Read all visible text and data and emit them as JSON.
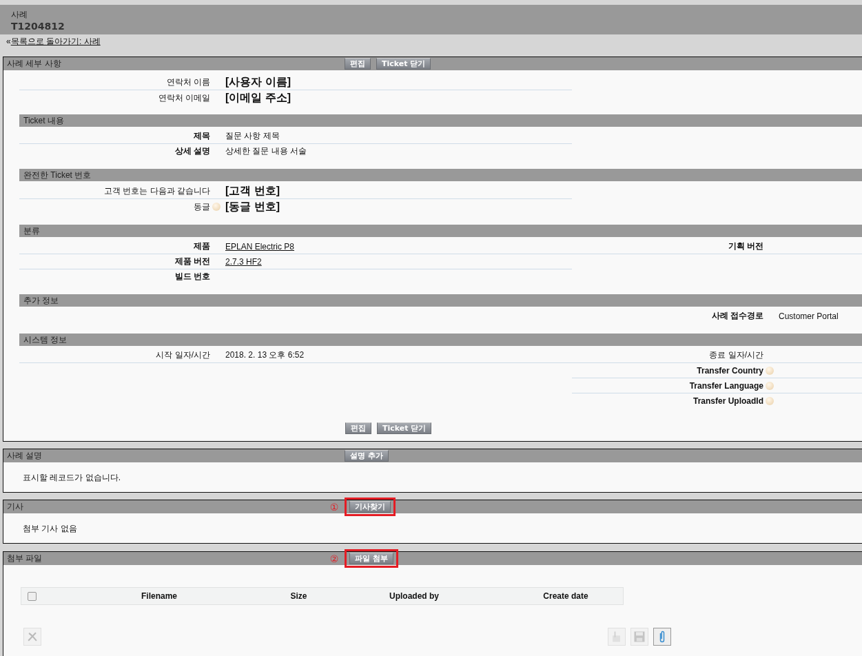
{
  "header": {
    "object_type": "사례",
    "record_number": "T1204812"
  },
  "back_link": {
    "prefix": "«",
    "label": "목록으로 돌아가기: 사례"
  },
  "detail_panel": {
    "title": "사례 세부 사항",
    "buttons": [
      "편집",
      "Ticket 닫기"
    ],
    "sections": [
      {
        "rows": [
          {
            "left": {
              "label": "연락처 이름",
              "bold": false,
              "value": "[사용자 이름]",
              "kind": "large",
              "help": false
            }
          },
          {
            "left": {
              "label": "연락처 이메일",
              "bold": false,
              "value": "[이메일 주소]",
              "kind": "large",
              "help": false
            }
          }
        ]
      },
      {
        "title": "Ticket 내용",
        "rows": [
          {
            "left": {
              "label": "제목",
              "bold": true,
              "value": "질문 사항 제목",
              "kind": "text",
              "help": false
            }
          },
          {
            "left": {
              "label": "상세 설명",
              "bold": true,
              "value": "상세한 질문 내용 서술",
              "kind": "text",
              "help": false
            }
          }
        ]
      },
      {
        "title": "완전한 Ticket 번호",
        "rows": [
          {
            "left": {
              "label": "고객 번호는 다음과 같습니다",
              "bold": false,
              "value": "[고객 번호]",
              "kind": "large",
              "help": false
            }
          },
          {
            "left": {
              "label": "동글",
              "bold": false,
              "value": "[동글 번호]",
              "kind": "large",
              "help": true
            }
          }
        ]
      },
      {
        "title": "분류",
        "rows": [
          {
            "left": {
              "label": "제품",
              "bold": true,
              "value": "EPLAN Electric P8",
              "kind": "link",
              "help": false
            },
            "right": {
              "label": "기획 버전",
              "bold": true,
              "help": false
            }
          },
          {
            "left": {
              "label": "제품 버전",
              "bold": true,
              "value": "2.7.3 HF2",
              "kind": "link",
              "help": false
            }
          },
          {
            "left": {
              "label": "빌드 번호",
              "bold": true,
              "help": false
            }
          }
        ]
      },
      {
        "title": "추가 정보",
        "rows": [
          {
            "right": {
              "label": "사례 접수경로",
              "bold": true,
              "value": "Customer Portal",
              "kind": "text",
              "help": false
            }
          }
        ]
      },
      {
        "title": "시스템 정보",
        "rows": [
          {
            "left": {
              "label": "시작 일자/시간",
              "bold": false,
              "value": "2018. 2. 13 오후 6:52",
              "kind": "text",
              "help": false
            },
            "right": {
              "label": "종료 일자/시간",
              "bold": false,
              "help": false
            }
          },
          {
            "right": {
              "label": "Transfer Country",
              "bold": true,
              "help": true
            }
          },
          {
            "right": {
              "label": "Transfer Language",
              "bold": true,
              "help": true
            }
          },
          {
            "right": {
              "label": "Transfer UploadId",
              "bold": true,
              "help": true
            }
          }
        ]
      }
    ],
    "footer_buttons": [
      "편집",
      "Ticket 닫기"
    ]
  },
  "related_panels": [
    {
      "title": "사례 설명",
      "button": "설명 추가",
      "highlighted": false,
      "message": "표시할 레코드가 없습니다."
    },
    {
      "title": "기사",
      "marker": "①",
      "button": "기사찾기",
      "highlighted": true,
      "message": "첨부 기사 없음"
    }
  ],
  "attachments": {
    "title": "첨부 파일",
    "marker": "②",
    "button": "파일 첨부",
    "highlighted": true,
    "select_all_checked": false,
    "columns": [
      "Filename",
      "Size",
      "Uploaded by",
      "Create date"
    ],
    "left_tools": [
      {
        "kind": "delete",
        "disabled": true
      }
    ],
    "right_tools": [
      {
        "kind": "check-out",
        "disabled": true
      },
      {
        "kind": "save",
        "disabled": true
      },
      {
        "kind": "attach",
        "disabled": false
      }
    ]
  }
}
